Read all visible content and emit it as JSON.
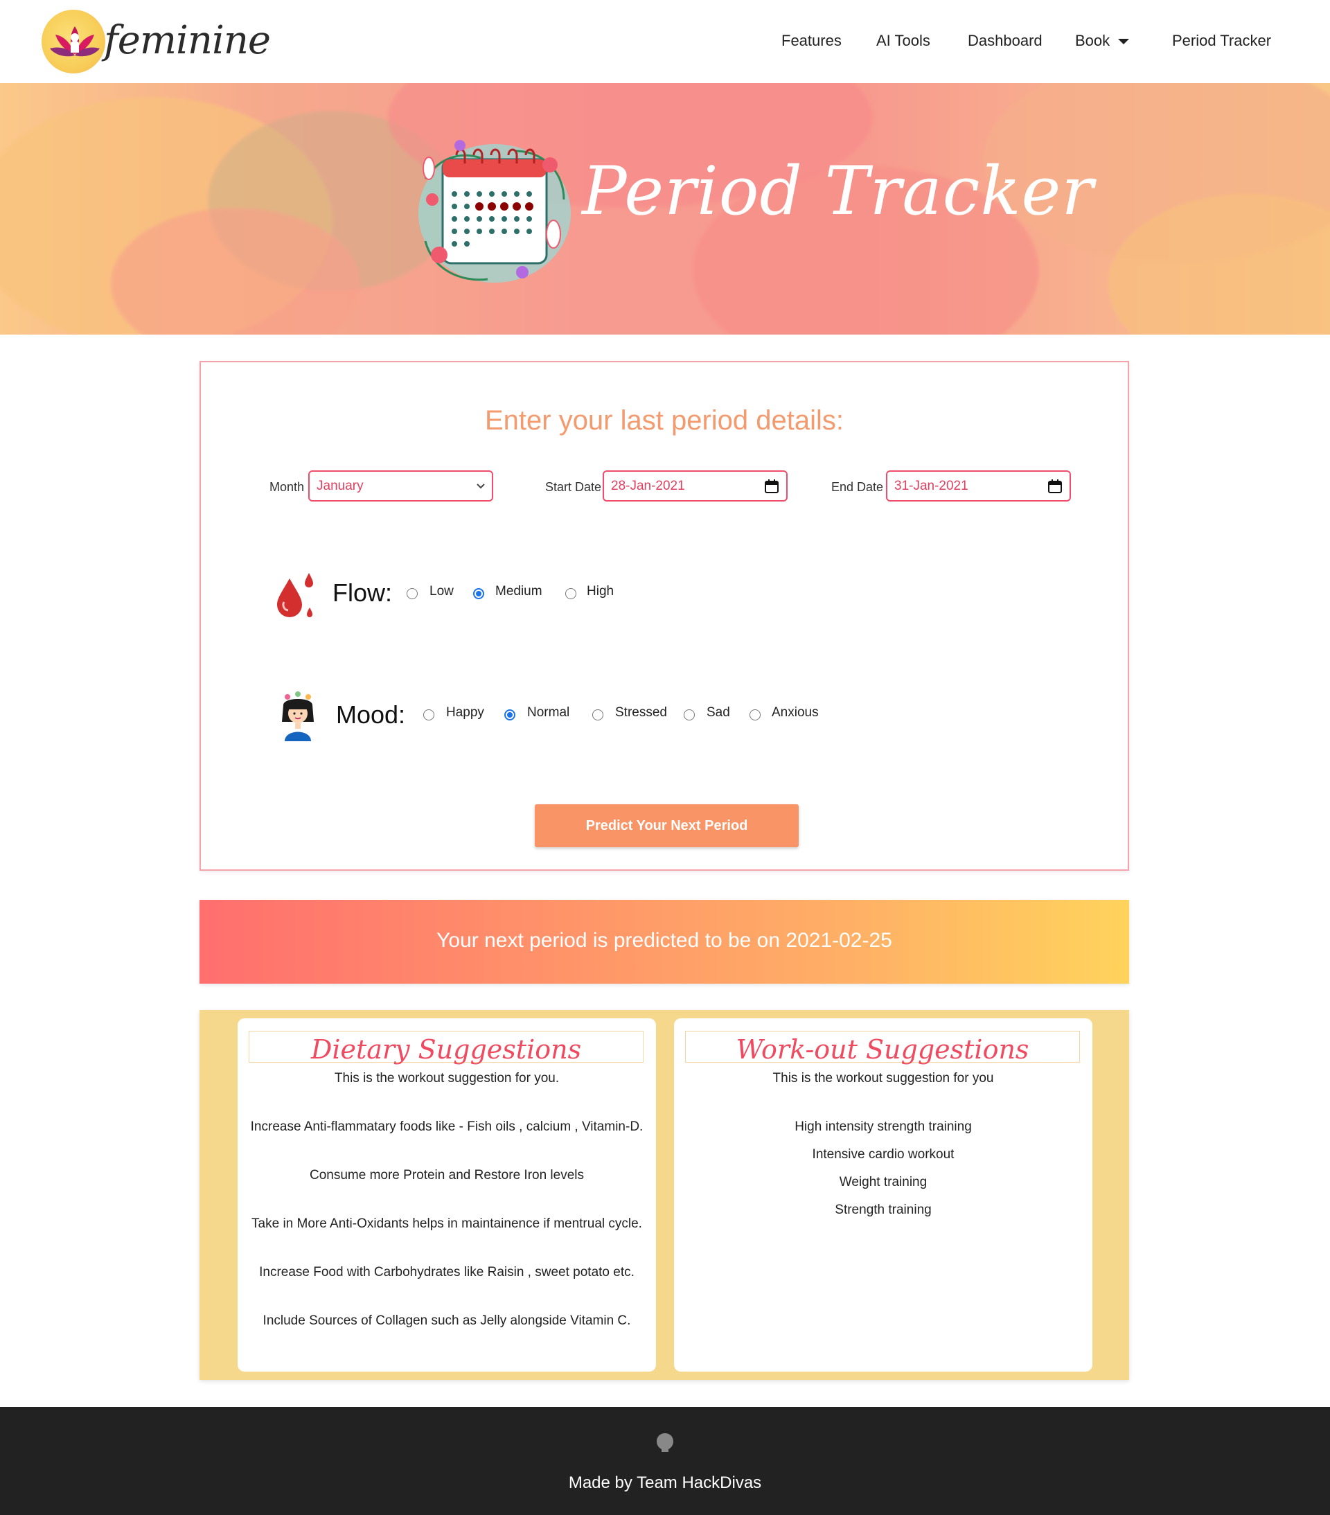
{
  "nav": {
    "logo_text": "feminine",
    "links": {
      "features": "Features",
      "ai_tools": "AI Tools",
      "dashboard": "Dashboard",
      "book": "Book",
      "period_tracker": "Period Tracker"
    }
  },
  "hero": {
    "title": "Period Tracker",
    "calendar_icon": "calendar-icon"
  },
  "form": {
    "heading": "Enter your last period details:",
    "month_label": "Month",
    "month_value": "January",
    "start_label": "Start Date",
    "start_value": "28-Jan-2021",
    "end_label": "End Date",
    "end_value": "31-Jan-2021",
    "flow_label": "Flow:",
    "flow_options": [
      "Low",
      "Medium",
      "High"
    ],
    "flow_selected": "Medium",
    "mood_label": "Mood:",
    "mood_options": [
      "Happy",
      "Normal",
      "Stressed",
      "Sad",
      "Anxious"
    ],
    "mood_selected": "Normal",
    "predict_button": "Predict Your Next Period"
  },
  "prediction": {
    "text": "Your next period is predicted to be on 2021-02-25"
  },
  "dietary": {
    "title": "Dietary Suggestions",
    "subtitle": "This is the workout suggestion for you.",
    "items": [
      "Increase Anti-flammatary foods like - Fish oils , calcium , Vitamin-D.",
      "Consume more Protein and Restore Iron levels",
      "Take in More Anti-Oxidants helps in maintainence if mentrual cycle.",
      "Increase Food with Carbohydrates like Raisin , sweet potato etc.",
      "Include Sources of Collagen such as Jelly alongside Vitamin C."
    ]
  },
  "workout": {
    "title": "Work-out Suggestions",
    "subtitle": "This is the workout suggestion for you",
    "items": [
      "High intensity strength training",
      "Intensive cardio workout",
      "Weight training",
      "Strength training"
    ]
  },
  "footer": {
    "text": "Made by Team HackDivas",
    "icon": "github-icon"
  },
  "colors": {
    "accent": "#ef4d6a",
    "heading": "#f39a6e",
    "button": "#f99466",
    "suggestions_bg": "#f6d88d",
    "footer_bg": "#222222"
  }
}
